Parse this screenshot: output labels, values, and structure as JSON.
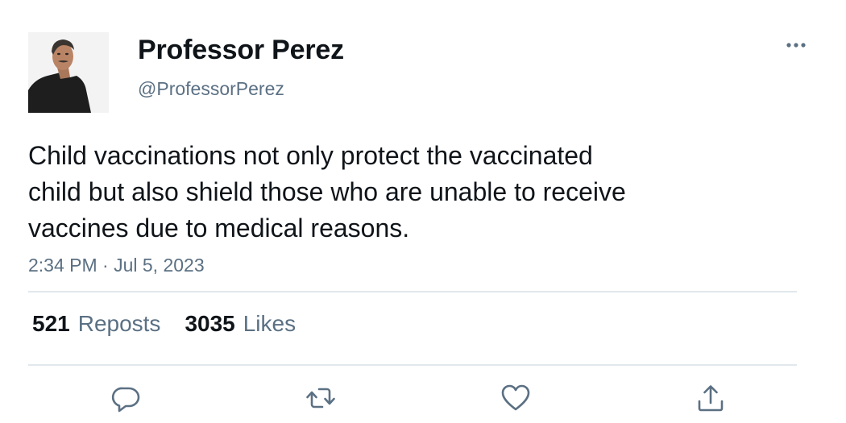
{
  "author": {
    "display_name": "Professor Perez",
    "handle": "@ProfessorPerez"
  },
  "tweet": {
    "text_lines": [
      "Child vaccinations not only protect the vaccinated",
      "child but also shield those who are unable to receive",
      "vaccines due to medical reasons."
    ],
    "timestamp": "2:34 PM · Jul 5, 2023"
  },
  "stats": {
    "reposts_count": "521",
    "reposts_label": "Reposts",
    "likes_count": "3035",
    "likes_label": "Likes"
  },
  "actions": {
    "reply_icon": "reply-icon",
    "repost_icon": "repost-icon",
    "like_icon": "heart-icon",
    "share_icon": "share-icon"
  },
  "colors": {
    "text_primary": "#0f1419",
    "text_secondary": "#5b7083",
    "divider": "#e1e8ed",
    "icon": "#5b7083"
  }
}
